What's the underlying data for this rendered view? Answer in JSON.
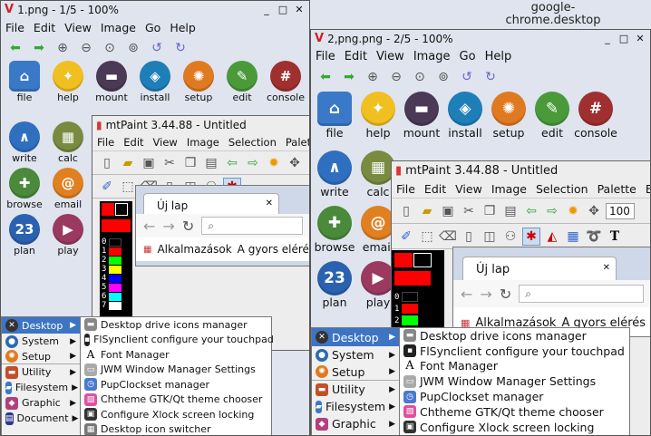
{
  "desktop": {
    "google_chrome_label": "google-chrome.desktop"
  },
  "window1": {
    "title": "1.png - 1/5 - 100%",
    "menu": [
      "File",
      "Edit",
      "View",
      "Image",
      "Go",
      "Help"
    ]
  },
  "window2": {
    "title": "2,png.png - 2/5 - 100%",
    "menu": [
      "File",
      "Edit",
      "View",
      "Image",
      "Go",
      "Help"
    ]
  },
  "desktop_icons": [
    {
      "label": "file",
      "icon": "home-folder-icon",
      "color": "#3a79c8"
    },
    {
      "label": "help",
      "icon": "lightbulb-icon",
      "color": "#f0c020"
    },
    {
      "label": "mount",
      "icon": "toggle-icon",
      "color": "#4a3a55"
    },
    {
      "label": "install",
      "icon": "box-icon",
      "color": "#1e7fb8"
    },
    {
      "label": "setup",
      "icon": "gear-icon",
      "color": "#e07a20"
    },
    {
      "label": "edit",
      "icon": "pencil-icon",
      "color": "#4a9a3a"
    },
    {
      "label": "console",
      "icon": "terminal-icon",
      "color": "#a03030"
    },
    {
      "label": "write",
      "icon": "writer-icon",
      "color": "#2f6fc0"
    },
    {
      "label": "calc",
      "icon": "calculator-icon",
      "color": "#7a8a40"
    },
    {
      "label": "browse",
      "icon": "globe-icon",
      "color": "#4a8a3a"
    },
    {
      "label": "email",
      "icon": "at-icon",
      "color": "#e08020"
    },
    {
      "label": "plan",
      "icon": "calendar-icon",
      "color": "#2a62b0"
    },
    {
      "label": "play",
      "icon": "film-icon",
      "color": "#9a3a60"
    }
  ],
  "mtpaint": {
    "title": "mtPaint 3.44.88 - Untitled",
    "menu1": [
      "File",
      "Edit",
      "View",
      "Image",
      "Selection",
      "Palette",
      "E"
    ],
    "menu2": [
      "File",
      "Edit",
      "View",
      "Image",
      "Selection",
      "Palette",
      "Eff"
    ],
    "zoom_value": "100",
    "palette_numbers": [
      "0",
      "1",
      "2",
      "3",
      "4",
      "5",
      "6",
      "7"
    ],
    "palette_colors": [
      "#000000",
      "#ff0000",
      "#00ff00",
      "#ffff00",
      "#0000ff",
      "#ff00ff",
      "#00ffff",
      "#ffffff"
    ]
  },
  "chrome": {
    "tab_title": "Új lap",
    "bookmark_apps": "Alkalmazások",
    "bookmark_text": "A gyors elérés érde",
    "bookmark_text2": "A gyors elérés"
  },
  "menu": {
    "items": [
      {
        "label": "Desktop",
        "icon": "desktop-icon",
        "color": "#333333"
      },
      {
        "label": "System",
        "icon": "system-icon",
        "color": "#2a6ab0"
      },
      {
        "label": "Setup",
        "icon": "setup-gear-icon",
        "color": "#e07a20"
      },
      {
        "label": "Utility",
        "icon": "utility-icon",
        "color": "#c0502a"
      },
      {
        "label": "Filesystem",
        "icon": "filesystem-icon",
        "color": "#3a79c8"
      },
      {
        "label": "Graphic",
        "icon": "graphic-icon",
        "color": "#b04080"
      },
      {
        "label": "Document",
        "icon": "document-icon",
        "color": "#2a3a8a"
      }
    ],
    "submenu": [
      {
        "label": "Desktop drive icons manager",
        "icon": "drive-icon"
      },
      {
        "label": "FlSynclient configure your touchpad",
        "icon": "touchpad-icon"
      },
      {
        "label": "Font Manager",
        "icon": "font-icon"
      },
      {
        "label": "JWM Window Manager Settings",
        "icon": "window-settings-icon"
      },
      {
        "label": "PupClockset manager",
        "icon": "clock-icon"
      },
      {
        "label": "Chtheme GTK/Qt theme chooser",
        "icon": "theme-icon"
      },
      {
        "label": "Configure Xlock screen locking",
        "icon": "lock-icon"
      },
      {
        "label": "Desktop icon switcher",
        "icon": "icon-switcher-icon"
      }
    ]
  }
}
